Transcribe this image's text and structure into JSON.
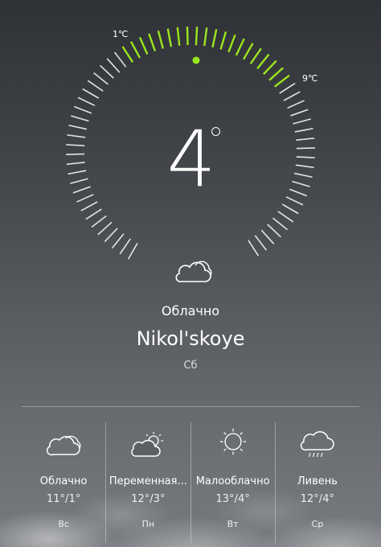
{
  "current": {
    "temp": "4",
    "min_label": "1℃",
    "max_label": "9℃",
    "condition": "Облачно",
    "city": "Nikol'skoye",
    "day": "Сб",
    "accent_color": "#9be51f"
  },
  "forecast": [
    {
      "condition": "Облачно",
      "temps": "11°/1°",
      "day": "Вс",
      "icon": "cloudy-icon"
    },
    {
      "condition": "Переменная...",
      "temps": "12°/3°",
      "day": "Пн",
      "icon": "partly-cloudy-icon"
    },
    {
      "condition": "Малооблачно",
      "temps": "13°/4°",
      "day": "Вт",
      "icon": "sun-icon"
    },
    {
      "condition": "Ливень",
      "temps": "12°/4°",
      "day": "Ср",
      "icon": "rain-shower-icon"
    }
  ]
}
